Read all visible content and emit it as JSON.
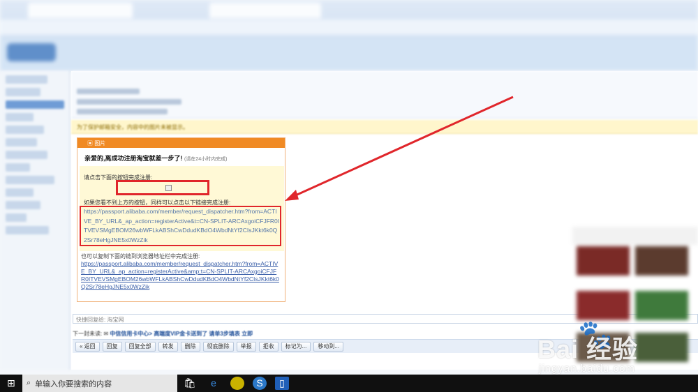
{
  "email": {
    "header_image_label": "图片",
    "greeting": "亲爱的,离成功注册淘宝就差一步了!",
    "greeting_note": "(请在24小时内完成)",
    "click_button_instruction": "请点击下面的按钮完成注册:",
    "alt_link_instruction": "如果您看不到上方的按钮，同样可以点击以下链接完成注册:",
    "link_primary": "https://passport.alibaba.com/member/request_dispatcher.htm?from=ACTIVE_BY_URL&_ap_action=registerActive&t=CN-SPLIT-ARCAxgoiCFJFR0ITVEVSMgEBOM26wbWFLkABShCwDdudKBdO4WbdNtYf2CIsJKkt6k0Q2Sr78eHgJNE5x0WzZik",
    "copy_instruction": "也可以复制下面的链到浏览器地址栏中完成注册:",
    "link_copy": "https://passport.alibaba.com/member/request_dispatcher.htm?from=ACTIVE_BY_URL&_ap_action=registerActive&amp;t=CN-SPLIT-ARCAxgoiCFJFR0ITVEVSMgEBOM26wbWFLkABShCwDdudKBdO4WbdNtYf2CIsJKkt6k0Q2Sr78eHgJNE5x0WzZik"
  },
  "notice": {
    "text": "为了保护邮箱安全，内容中的图片未被显示。"
  },
  "quick_reply": {
    "placeholder": "快捷回复给: 淘宝网"
  },
  "next_mail": {
    "prefix": "下一封未读:",
    "sender": "中信信用卡中心>",
    "subject": "高端度VIP金卡送到了 请单3步填表 立即"
  },
  "toolbar": {
    "buttons": [
      "« 返回",
      "回复",
      "回复全部",
      "转发",
      "删除",
      "彻底删除",
      "举报",
      "拒收",
      "标记为...",
      "移动到..."
    ]
  },
  "taskbar": {
    "search_text": "单输入你要搜索的内容"
  },
  "watermark": {
    "brand": "Bai  经验",
    "url": "jingyan.baidu.com"
  },
  "colors": {
    "highlight_red": "#e0262b",
    "email_orange": "#f08a24",
    "link_blue": "#3a5fa8"
  }
}
